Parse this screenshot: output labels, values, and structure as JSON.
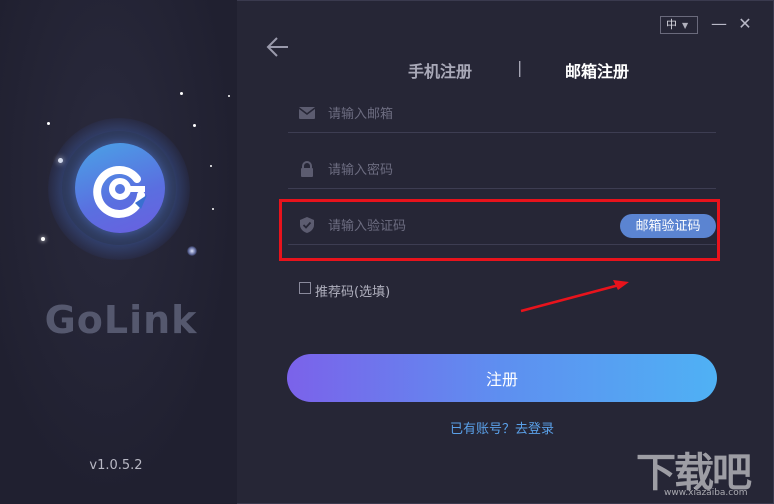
{
  "app": {
    "brand": "GoLink",
    "version": "v1.0.5.2"
  },
  "titlebar": {
    "language": "中",
    "minimize": "—",
    "close": "✕"
  },
  "tabs": {
    "phone": "手机注册",
    "separator": "|",
    "email": "邮箱注册"
  },
  "form": {
    "email_placeholder": "请输入邮箱",
    "password_placeholder": "请输入密码",
    "code_placeholder": "请输入验证码",
    "code_button": "邮箱验证码",
    "referral_label": "推荐码(选填)",
    "submit": "注册",
    "login_link": "已有账号？去登录"
  },
  "watermark": {
    "main": "下载吧",
    "sub": "www.xiazaiba.com"
  },
  "colors": {
    "accent": "#5b84d1",
    "highlight": "#e8131c",
    "link": "#5aa0e8"
  }
}
